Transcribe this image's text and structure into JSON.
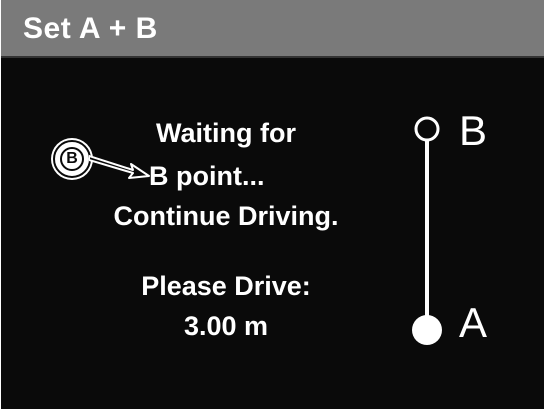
{
  "header": {
    "title": "Set A + B"
  },
  "message": {
    "line1": "Waiting for",
    "line2": "B point...",
    "line3": "Continue Driving.",
    "line4": "Please Drive:",
    "line5": "3.00 m",
    "badge_letter": "B"
  },
  "path": {
    "start_label": "A",
    "end_label": "B"
  },
  "colors": {
    "title_bar": "#7a7a7a",
    "background": "#0a0a0a",
    "text": "#ffffff"
  }
}
